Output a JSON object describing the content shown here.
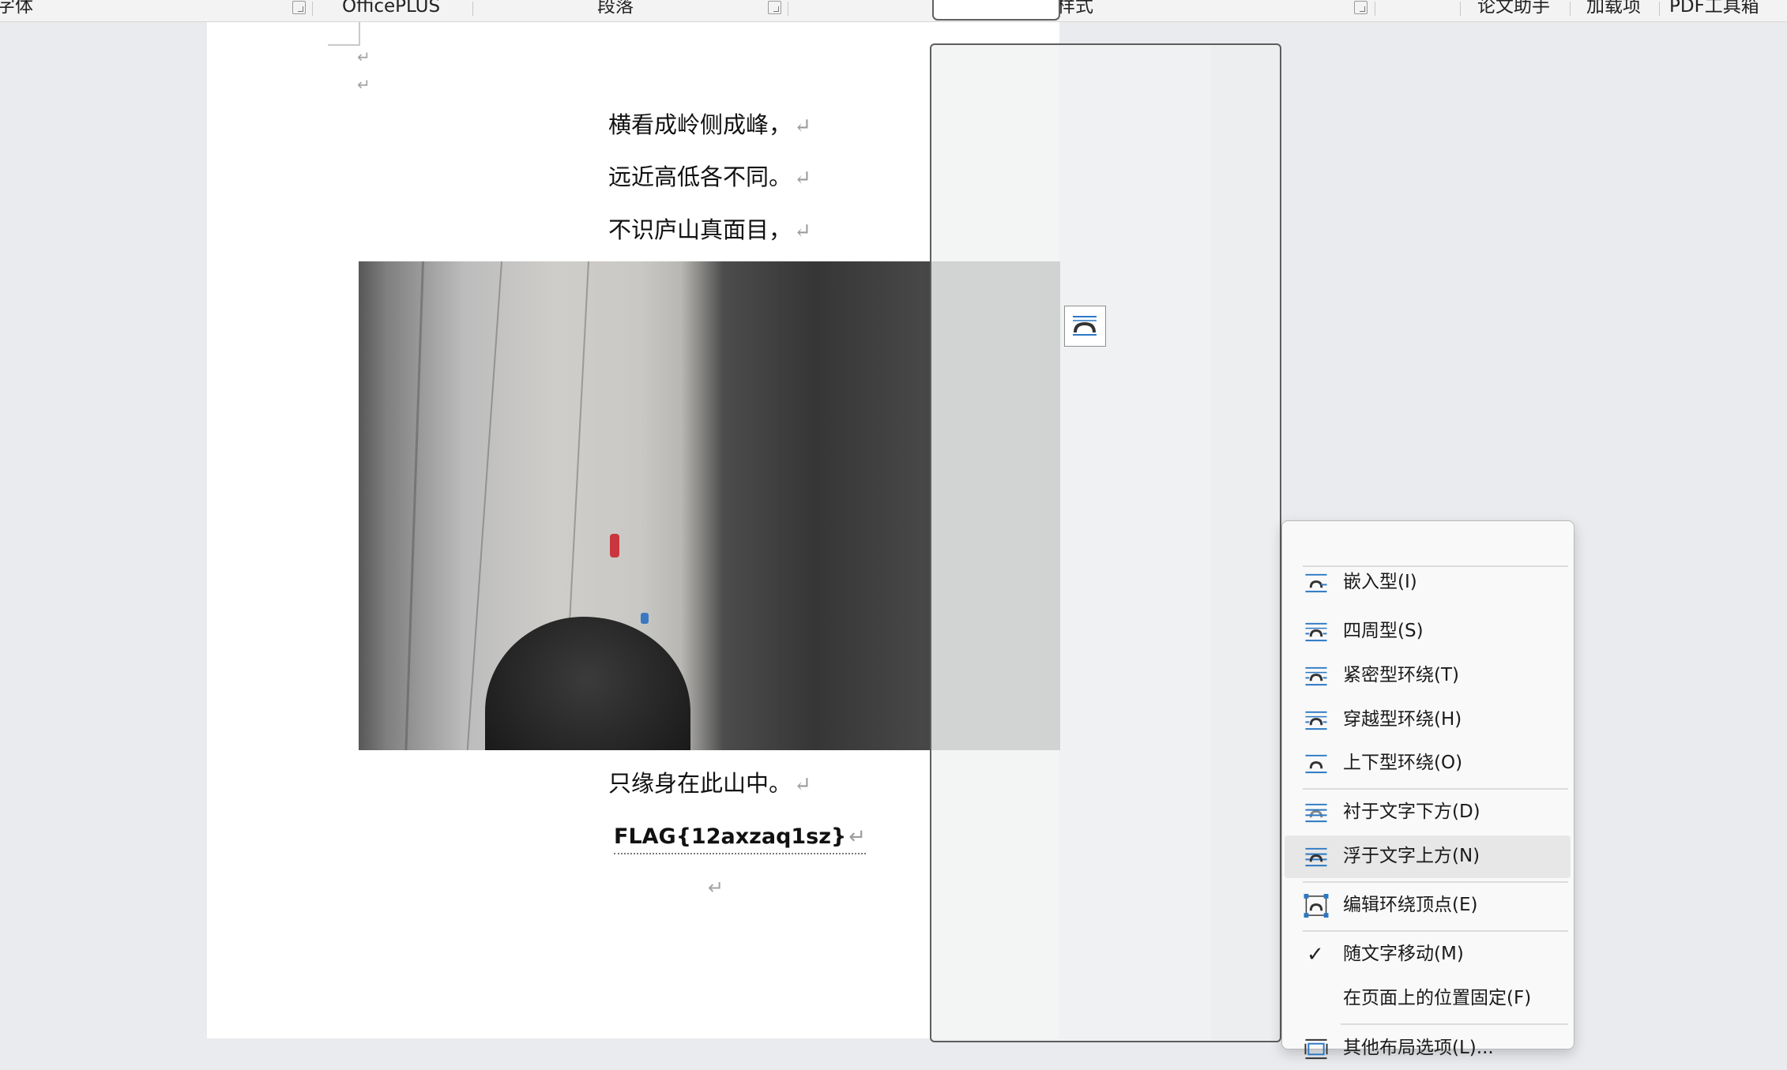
{
  "ribbon": {
    "font_group": "字体",
    "officeplus": "OfficePLUS",
    "paragraph": "段落",
    "styles": "样式",
    "thesis": "论文助手",
    "addins": "加载项",
    "pdf": "PDF工具箱"
  },
  "document": {
    "poem_lines": [
      "横看成岭侧成峰，",
      "远近高低各不同。",
      "不识庐山真面目，",
      "只缘身在此山中。"
    ],
    "flag": "FLAG{12axzaq1sz}",
    "para_mark": "↵"
  },
  "layout_options_icon": "wrap-inline-icon",
  "context_menu": {
    "items": [
      {
        "label": "嵌入型(I)",
        "icon": "wrap-inline-icon"
      },
      {
        "label": "四周型(S)",
        "icon": "wrap-square-icon"
      },
      {
        "label": "紧密型环绕(T)",
        "icon": "wrap-tight-icon"
      },
      {
        "label": "穿越型环绕(H)",
        "icon": "wrap-through-icon"
      },
      {
        "label": "上下型环绕(O)",
        "icon": "wrap-top-bottom-icon"
      },
      {
        "label": "衬于文字下方(D)",
        "icon": "behind-text-icon"
      },
      {
        "label": "浮于文字上方(N)",
        "icon": "in-front-text-icon"
      },
      {
        "label": "编辑环绕顶点(E)",
        "icon": "edit-wrap-points-icon"
      },
      {
        "label": "随文字移动(M)",
        "icon": "checkmark-icon"
      },
      {
        "label": "在页面上的位置固定(F)",
        "icon": ""
      },
      {
        "label": "其他布局选项(L)...",
        "icon": "more-layout-icon"
      }
    ],
    "highlighted": "浮于文字上方(N)",
    "accent_color": "#2b78c4"
  }
}
